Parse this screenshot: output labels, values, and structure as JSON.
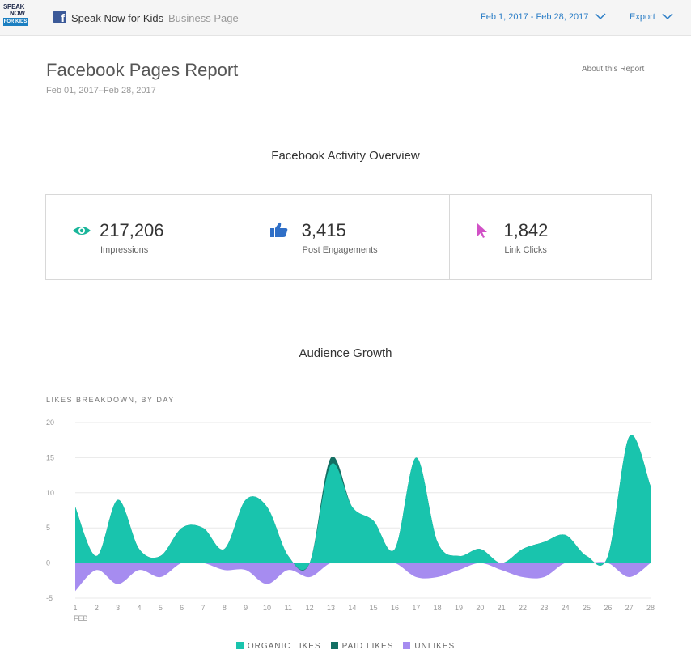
{
  "topbar": {
    "logo_lines": [
      "SPEAK",
      "NOW",
      "FOR KIDS"
    ],
    "page_name": "Speak Now for Kids",
    "page_type": "Business Page",
    "date_range": "Feb 1, 2017 - Feb 28, 2017",
    "export_label": "Export"
  },
  "header": {
    "title": "Facebook Pages Report",
    "date": "Feb 01, 2017–Feb 28, 2017",
    "about_link": "About this Report"
  },
  "overview": {
    "title": "Facebook Activity Overview",
    "stats": [
      {
        "value": "217,206",
        "label": "Impressions",
        "icon": "eye-icon",
        "color": "#19b59a"
      },
      {
        "value": "3,415",
        "label": "Post Engagements",
        "icon": "thumbs-up-icon",
        "color": "#2f6fc7"
      },
      {
        "value": "1,842",
        "label": "Link Clicks",
        "icon": "cursor-icon",
        "color": "#d151c6"
      }
    ]
  },
  "audience": {
    "title": "Audience Growth",
    "breakdown_label": "LIKES BREAKDOWN, BY DAY"
  },
  "chart_data": {
    "type": "area",
    "x": [
      1,
      2,
      3,
      4,
      5,
      6,
      7,
      8,
      9,
      10,
      11,
      12,
      13,
      14,
      15,
      16,
      17,
      18,
      19,
      20,
      21,
      22,
      23,
      24,
      25,
      26,
      27,
      28
    ],
    "x_month_label": "FEB",
    "ylim": [
      -5,
      20
    ],
    "yticks": [
      -5,
      0,
      5,
      10,
      15,
      20
    ],
    "grid": true,
    "legend_position": "bottom",
    "series": [
      {
        "name": "ORGANIC LIKES",
        "color": "#19c4ad",
        "values": [
          8,
          1,
          9,
          2,
          1,
          5,
          5,
          2,
          9,
          8,
          1,
          0,
          14,
          8,
          6,
          2,
          15,
          3,
          1,
          2,
          0,
          2,
          3,
          4,
          1,
          1,
          18,
          11
        ]
      },
      {
        "name": "PAID LIKES",
        "color": "#136f63",
        "values": [
          0,
          0,
          0,
          0,
          0,
          0,
          0,
          0,
          0,
          0,
          0,
          0,
          1,
          0,
          0,
          0,
          0,
          0,
          0,
          0,
          0,
          0,
          0,
          0,
          0,
          0,
          0,
          0
        ]
      },
      {
        "name": "UNLIKES",
        "color": "#a68cf0",
        "values": [
          -4,
          -1,
          -3,
          -1,
          -2,
          0,
          0,
          -1,
          -1,
          -3,
          -1,
          -2,
          0,
          0,
          0,
          0,
          -2,
          -2,
          -1,
          0,
          -1,
          -2,
          -2,
          0,
          0,
          0,
          -2,
          0
        ]
      }
    ]
  }
}
